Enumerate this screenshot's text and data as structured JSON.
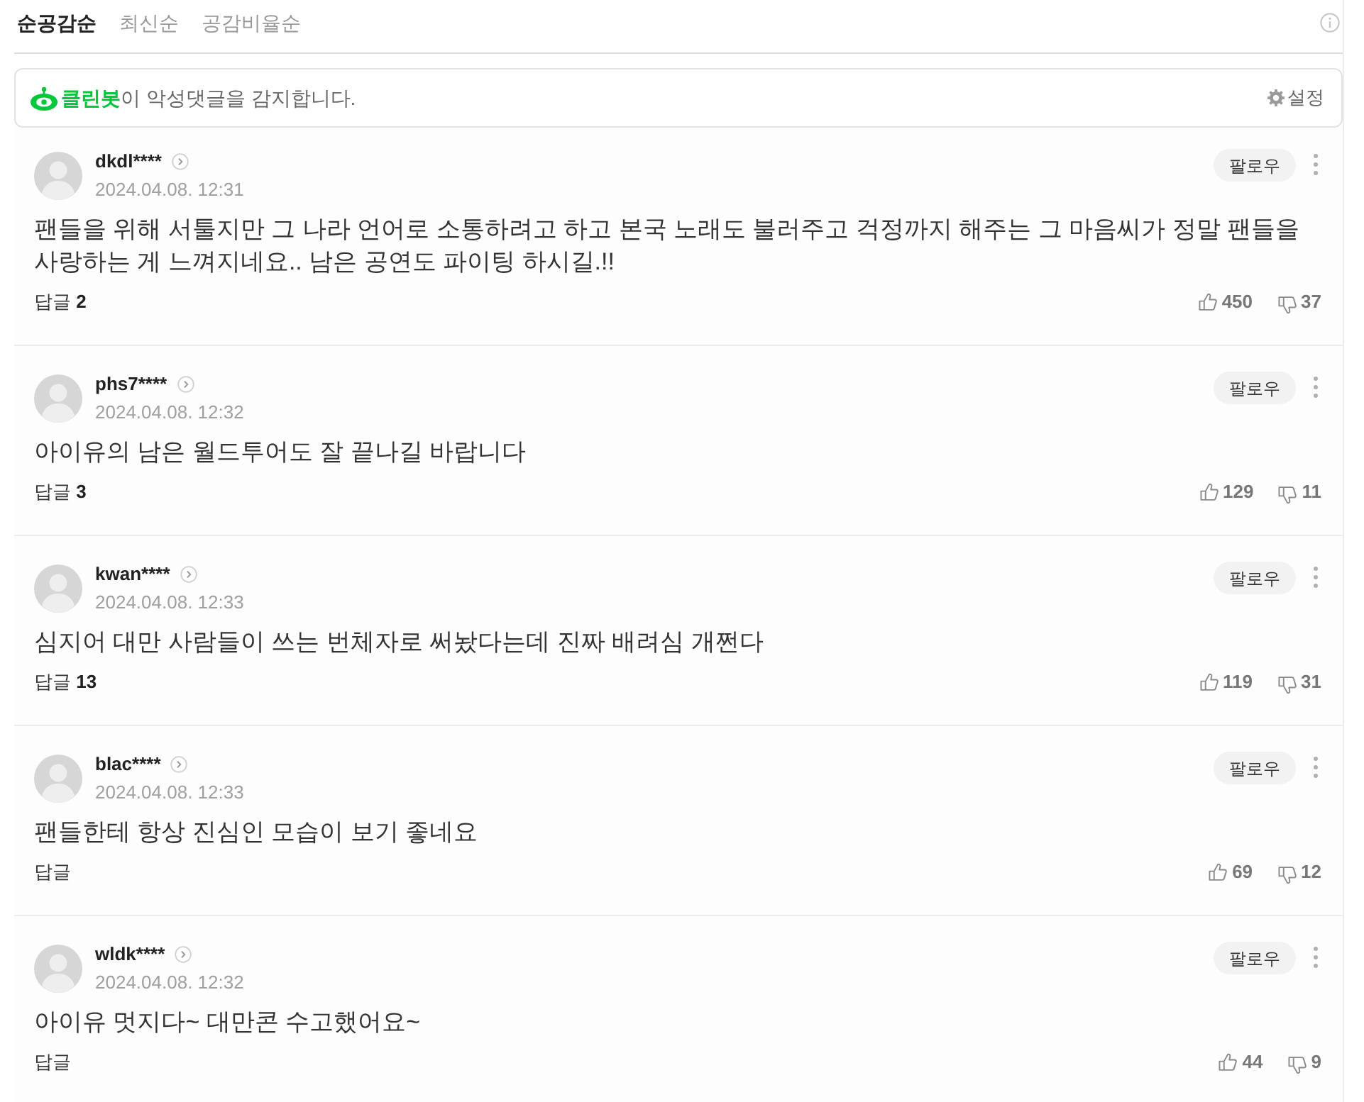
{
  "sort_tabs": [
    {
      "label": "순공감순",
      "selected": true
    },
    {
      "label": "최신순",
      "selected": false
    },
    {
      "label": "공감비율순",
      "selected": false
    }
  ],
  "cleanbot": {
    "message": "**클린봇**이 악성댓글을 감지합니다.",
    "settings_label": "설정"
  },
  "comments": [
    {
      "username": "dkdl****",
      "date": "2024.04.08. 12:31",
      "text": "팬들을 위해 서툴지만 그 나라 언어로 소통하려고 하고 본국 노래도 불러주고 걱정까지 해주는 그 마음씨가 정말 팬들을 사랑하는 게 느껴지네요.. 남은 공연도 파이팅 하시길.!!",
      "follow_label": "팔로우",
      "reply_label": "답글",
      "reply_count": "2",
      "likes": "450",
      "dislikes": "37"
    },
    {
      "username": "phs7****",
      "date": "2024.04.08. 12:32",
      "text": "아이유의 남은 월드투어도 잘 끝나길 바랍니다",
      "follow_label": "팔로우",
      "reply_label": "답글",
      "reply_count": "3",
      "likes": "129",
      "dislikes": "11"
    },
    {
      "username": "kwan****",
      "date": "2024.04.08. 12:33",
      "text": "심지어 대만 사람들이 쓰는 번체자로 써놨다는데 진짜 배려심 개쩐다",
      "follow_label": "팔로우",
      "reply_label": "답글",
      "reply_count": "13",
      "likes": "119",
      "dislikes": "31"
    },
    {
      "username": "blac****",
      "date": "2024.04.08. 12:33",
      "text": "팬들한테 항상 진심인 모습이 보기 좋네요",
      "follow_label": "팔로우",
      "reply_label": "답글",
      "likes": "69",
      "dislikes": "12"
    },
    {
      "username": "wldk****",
      "date": "2024.04.08. 12:32",
      "text": "아이유 멋지다~ 대만콘 수고했어요~",
      "follow_label": "팔로우",
      "reply_label": "답글",
      "likes": "44",
      "dislikes": "9"
    }
  ]
}
